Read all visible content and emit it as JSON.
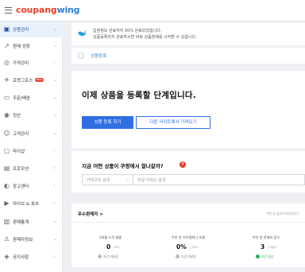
{
  "app": {
    "logo_part1": "coupang",
    "logo_part2": "wing"
  },
  "sidebar": {
    "items": [
      {
        "label": "상품관리",
        "icon": "box-icon",
        "glyph": "▣",
        "active": true
      },
      {
        "label": "판매 성장",
        "icon": "trend-up-icon",
        "glyph": "↗"
      },
      {
        "label": "가격관리",
        "icon": "price-icon",
        "glyph": "◎"
      },
      {
        "label": "로켓그로스",
        "icon": "rocket-icon",
        "glyph": "✈",
        "badge": "NEW"
      },
      {
        "label": "주문/배송",
        "icon": "truck-icon",
        "glyph": "▭"
      },
      {
        "label": "정산",
        "icon": "settlement-icon",
        "glyph": "◉"
      },
      {
        "label": "고객관리",
        "icon": "customer-icon",
        "glyph": "☺"
      },
      {
        "label": "마이샵",
        "icon": "shop-icon",
        "glyph": "▢"
      },
      {
        "label": "프로모션",
        "icon": "promotion-icon",
        "glyph": "▤"
      },
      {
        "label": "광고센터",
        "icon": "ad-icon",
        "glyph": "◐"
      },
      {
        "label": "라이브 & 숏츠",
        "icon": "live-icon",
        "glyph": "▶"
      },
      {
        "label": "판매통계",
        "icon": "stats-icon",
        "glyph": "▥"
      },
      {
        "label": "판매자정보",
        "icon": "user-icon",
        "glyph": "♙"
      },
      {
        "label": "공지사항",
        "icon": "notice-icon",
        "glyph": "◈"
      }
    ]
  },
  "notice": {
    "line1": "입점정보 완료까지 50% 완료되었습니다.",
    "line2": "상품등록까지 완료하시면 바로 상품판매를 시작할 수 있습니다."
  },
  "steps": {
    "label": "상품등록"
  },
  "hero": {
    "title": "이제 상품을 등록할 단계입니다.",
    "primary_button": "상품 등록 하기",
    "secondary_button": "다른 사이트에서 가져오기"
  },
  "search": {
    "question": "지금 어떤 상품이 쿠팡에서 잘나갈까?",
    "help_glyph": "?",
    "category_placeholder": "카테고리 검색",
    "keyword_placeholder": "한글 키워드 검색"
  },
  "seller": {
    "heading": "우수판매자 >",
    "period": "이번 달 업로드에서입니다",
    "metrics": [
      {
        "label": "3개월 누적 매출",
        "value": "0",
        "unit": "/ 6억",
        "status": "조건 미달성",
        "ok": false
      },
      {
        "label": "이번 달 아이템위너 비율",
        "value": "0%",
        "unit": "/ 55%",
        "status": "조건 미달성",
        "ok": false
      },
      {
        "label": "이번 달 판매자 점수",
        "value": "3",
        "unit": "/ 4점이",
        "status": "조건 달성",
        "ok": true
      }
    ]
  },
  "colors": {
    "brand_red": "#e8412c",
    "brand_blue": "#2b7fd9",
    "primary_button": "#2f6fe4",
    "success": "#21b357"
  }
}
